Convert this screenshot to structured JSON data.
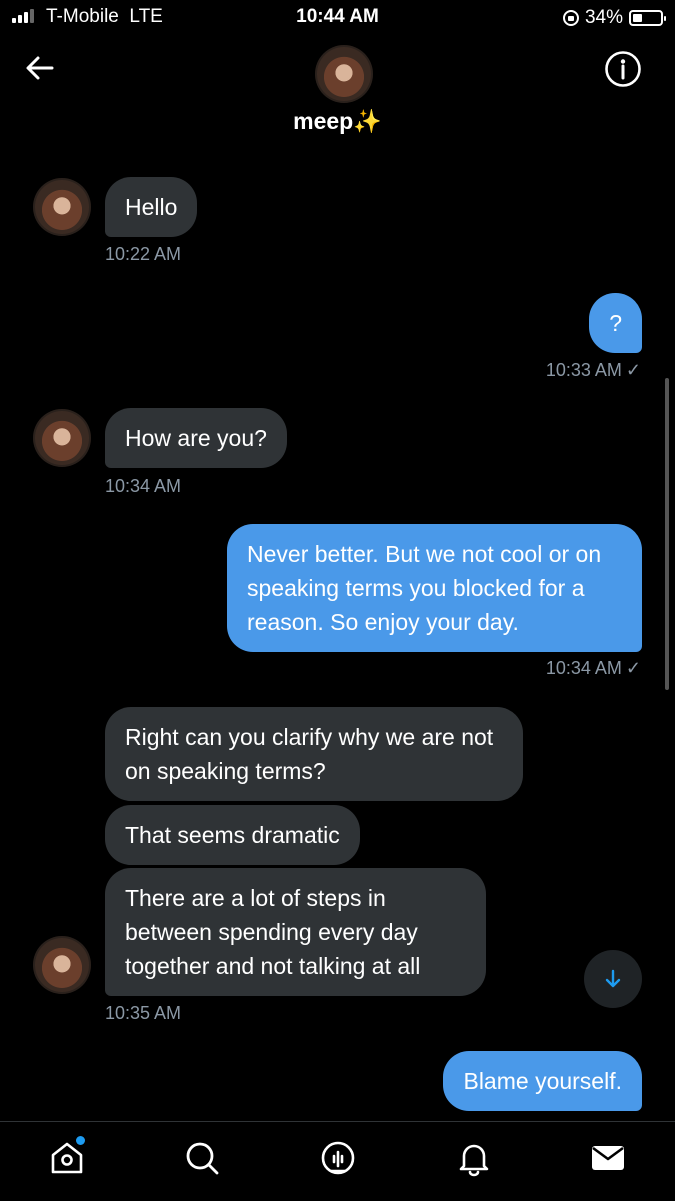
{
  "status_bar": {
    "carrier": "T-Mobile",
    "network": "LTE",
    "time": "10:44 AM",
    "battery": "34%",
    "battery_level": 0.34
  },
  "header": {
    "name": "meep✨",
    "back_icon": "arrow-left-icon",
    "info_icon": "info-icon"
  },
  "messages": [
    {
      "side": "in",
      "text": "Hello",
      "time": "10:22 AM"
    },
    {
      "side": "out",
      "text": "?",
      "time": "10:33 AM"
    },
    {
      "side": "in",
      "text": "How are you?",
      "time": "10:34 AM"
    },
    {
      "side": "out",
      "text": "Never better. But we not cool or on speaking terms you blocked for a reason. So enjoy your day.",
      "time": "10:34 AM"
    },
    {
      "side": "in",
      "text": "Right can you clarify why we are not on speaking terms?"
    },
    {
      "side": "in",
      "text": "That seems dramatic"
    },
    {
      "side": "in",
      "text": "There are a lot of steps in between spending every day together and not talking at all",
      "time": "10:35 AM"
    },
    {
      "side": "out",
      "text": "Blame yourself."
    }
  ],
  "read_check": "✓",
  "tabs": [
    "home-icon",
    "search-icon",
    "spaces-icon",
    "notifications-icon",
    "messages-icon"
  ]
}
